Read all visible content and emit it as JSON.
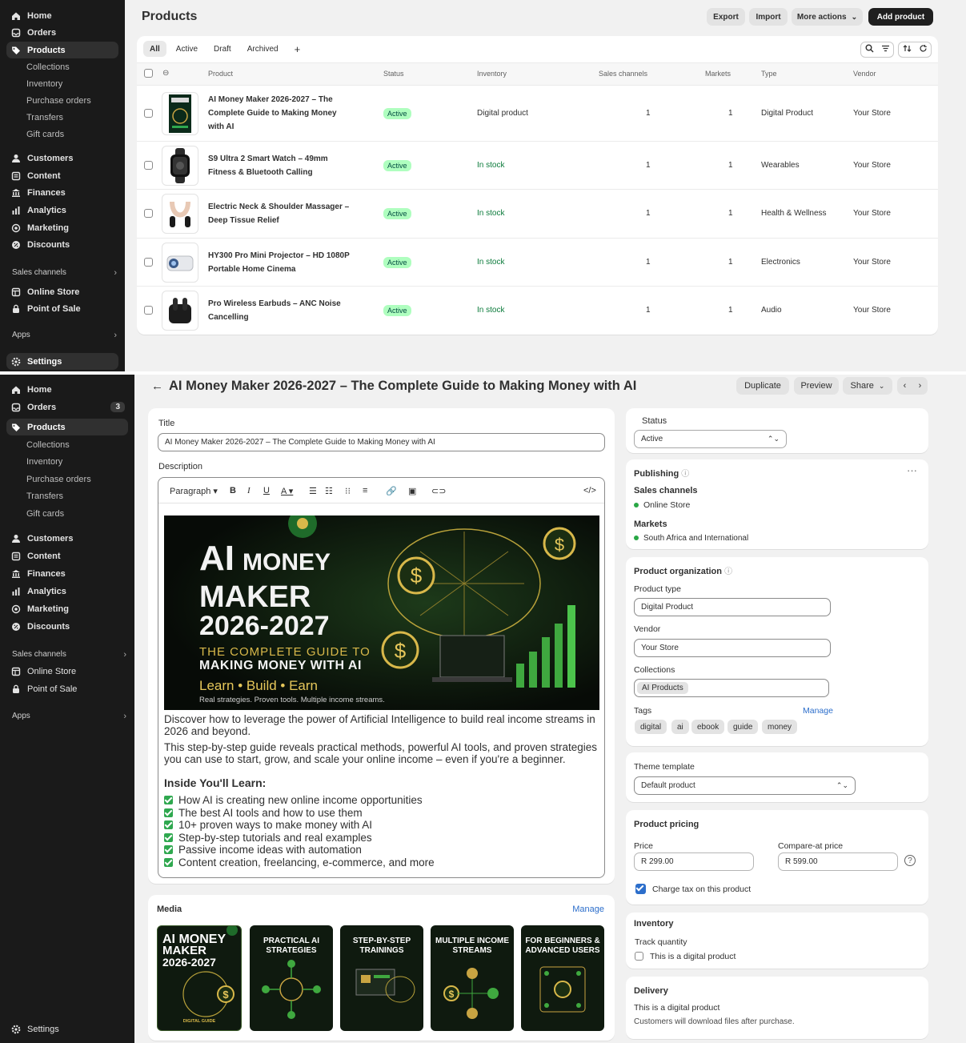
{
  "sidebar": {
    "items": [
      {
        "label": "Home",
        "icon": "home-icon"
      },
      {
        "label": "Orders",
        "icon": "orders-icon"
      },
      {
        "label": "Products",
        "icon": "tag-icon"
      },
      {
        "label": "Collections"
      },
      {
        "label": "Inventory"
      },
      {
        "label": "Purchase orders"
      },
      {
        "label": "Transfers"
      },
      {
        "label": "Gift cards"
      },
      {
        "label": "Customers",
        "icon": "person-icon"
      },
      {
        "label": "Content",
        "icon": "content-icon"
      },
      {
        "label": "Finances",
        "icon": "bank-icon"
      },
      {
        "label": "Analytics",
        "icon": "bar-chart-icon"
      },
      {
        "label": "Marketing",
        "icon": "target-icon"
      },
      {
        "label": "Discounts",
        "icon": "discount-icon"
      }
    ],
    "sales_channels": "Sales channels",
    "online_store": "Online Store",
    "pos": "Point of Sale",
    "apps": "Apps",
    "settings": "Settings",
    "orders_badge": "3"
  },
  "list": {
    "title": "Products",
    "export": "Export",
    "import": "Import",
    "more_actions": "More actions",
    "add_product": "Add product",
    "tabs": [
      "All",
      "Active",
      "Draft",
      "Archived",
      "+"
    ],
    "headers": [
      "Product",
      "Status",
      "Inventory",
      "Sales channels",
      "Markets",
      "Type",
      "Vendor"
    ],
    "rows": [
      {
        "name": "AI Money Maker 2026-2027 – The Complete Guide to Making Money with AI",
        "status": "Active",
        "inventory": "Digital product",
        "channels": "1",
        "markets": "1",
        "type": "Digital Product",
        "vendor": "Your Store"
      },
      {
        "name": "S9 Ultra 2 Smart Watch – 49mm Fitness & Bluetooth Calling",
        "status": "Active",
        "inventory": "In stock",
        "channels": "1",
        "markets": "1",
        "type": "Wearables",
        "vendor": "Your Store"
      },
      {
        "name": "Electric Neck & Shoulder Massager – Deep Tissue Relief",
        "status": "Active",
        "inventory": "In stock",
        "channels": "1",
        "markets": "1",
        "type": "Health & Wellness",
        "vendor": "Your Store"
      },
      {
        "name": "HY300 Pro Mini Projector – HD 1080P Portable Home Cinema",
        "status": "Active",
        "inventory": "In stock",
        "channels": "1",
        "markets": "1",
        "type": "Electronics",
        "vendor": "Your Store"
      },
      {
        "name": "Pro Wireless Earbuds – ANC Noise Cancelling",
        "status": "Active",
        "inventory": "In stock",
        "channels": "1",
        "markets": "1",
        "type": "Audio",
        "vendor": "Your Store"
      }
    ]
  },
  "detail": {
    "title": "AI Money Maker 2026-2027 – The Complete Guide to Making Money with AI",
    "duplicate": "Duplicate",
    "preview": "Preview",
    "share": "Share",
    "title_label": "Title",
    "title_value": "AI Money Maker 2026-2027 – The Complete Guide to Making Money with AI",
    "description_label": "Description",
    "paragraph": "Paragraph",
    "banner": {
      "ai": "AI",
      "money": "MONEY",
      "maker": "MAKER",
      "years": "2026-2027",
      "sub1": "THE COMPLETE GUIDE TO",
      "sub2": "MAKING MONEY WITH AI",
      "tagline": "Learn • Build • Earn",
      "small": "Real strategies. Proven tools. Multiple income streams."
    },
    "desc_p1": "Discover how to leverage the power of Artificial Intelligence to build real income streams in 2026 and beyond.",
    "desc_p2": "This step-by-step guide reveals practical methods, powerful AI tools, and proven strategies you can use to start, grow, and scale your online income – even if you're a beginner.",
    "desc_heading": "Inside You'll Learn:",
    "desc_list": [
      "How AI is creating new online income opportunities",
      "The best AI tools and how to use them",
      "10+ proven ways to make money with AI",
      "Step-by-step tutorials and real examples",
      "Passive income ideas with automation",
      "Content creation, freelancing, e-commerce, and more"
    ],
    "media_label": "Media",
    "media_manage": "Manage",
    "media": [
      {
        "line1": "AI MONEY",
        "line2": "MAKER",
        "line3": "2026-2027",
        "foot": "DIGITAL GUIDE"
      },
      {
        "text": "PRACTICAL AI STRATEGIES"
      },
      {
        "text": "STEP-BY-STEP TRAININGS"
      },
      {
        "text": "MULTIPLE INCOME STREAMS"
      },
      {
        "text": "FOR BEGINNERS & ADVANCED USERS"
      }
    ],
    "status_label": "Status",
    "status_value": "Active",
    "publishing": "Publishing",
    "sales_channels": "Sales channels",
    "online_store": "Online Store",
    "markets": "Markets",
    "markets_value": "South Africa and International",
    "org": "Product organization",
    "type_label": "Product type",
    "type_value": "Digital Product",
    "vendor_label": "Vendor",
    "vendor_value": "Your Store",
    "collections_label": "Collections",
    "collections_value": "AI Products",
    "tags_label": "Tags",
    "tags_manage": "Manage",
    "tags": [
      "digital",
      "ai",
      "ebook",
      "guide",
      "money"
    ],
    "theme_label": "Theme template",
    "theme_value": "Default product",
    "pricing": "Product pricing",
    "price_label": "Price",
    "price_value": "R  299.00",
    "compare_label": "Compare-at price",
    "compare_value": "R  599.00",
    "charge_tax": "Charge tax on this product",
    "inventory": "Inventory",
    "track_qty": "Track quantity",
    "digital_check": "This is a digital product",
    "delivery": "Delivery",
    "delivery_title": "This is a digital product",
    "delivery_desc": "Customers will download files after purchase."
  },
  "colors": {
    "sidebar": "#1a1a1a",
    "accent": "#2c6ecb",
    "active_pill": "#affebf",
    "stock": "#0a7a3a"
  }
}
